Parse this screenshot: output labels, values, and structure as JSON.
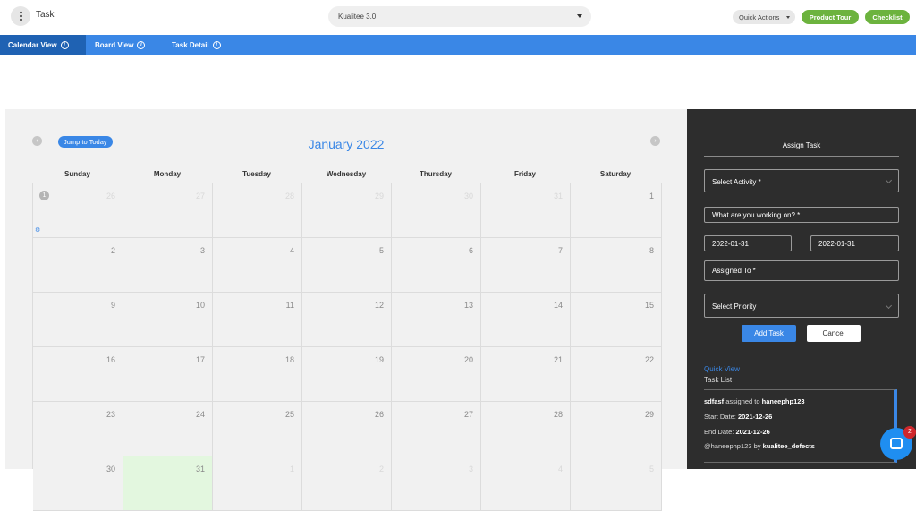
{
  "header": {
    "title": "Task",
    "project": "Kualitee 3.0",
    "quick_actions": "Quick Actions",
    "product_tour": "Product Tour",
    "checklist": "Checklist"
  },
  "tabs": [
    {
      "label": "Calendar View",
      "info": "i"
    },
    {
      "label": "Board View",
      "info": "i"
    },
    {
      "label": "Task Detail",
      "info": "i"
    }
  ],
  "calendar": {
    "jump_today": "Jump to Today",
    "prev_icon": "‹",
    "next_icon": "›",
    "month": "January 2022",
    "weekdays": [
      "Sunday",
      "Monday",
      "Tuesday",
      "Wednesday",
      "Thursday",
      "Friday",
      "Saturday"
    ],
    "weeks": [
      [
        "26",
        "27",
        "28",
        "29",
        "30",
        "31",
        "1"
      ],
      [
        "2",
        "3",
        "4",
        "5",
        "6",
        "7",
        "8"
      ],
      [
        "9",
        "10",
        "11",
        "12",
        "13",
        "14",
        "15"
      ],
      [
        "16",
        "17",
        "18",
        "19",
        "20",
        "21",
        "22"
      ],
      [
        "23",
        "24",
        "25",
        "26",
        "27",
        "28",
        "29"
      ],
      [
        "30",
        "31",
        "1",
        "2",
        "3",
        "4",
        "5"
      ]
    ],
    "event_badge": "1",
    "event_icon": "⚙"
  },
  "assign_task": {
    "title": "Assign Task",
    "activity_placeholder": "Select Activity *",
    "working_on_placeholder": "What are you working on? *",
    "start_date": "2022-01-31",
    "end_date": "2022-01-31",
    "assigned_placeholder": "Assigned To *",
    "priority_placeholder": "Select Priority",
    "add_label": "Add Task",
    "cancel_label": "Cancel"
  },
  "quick_view": {
    "label": "Quick View",
    "task_list_label": "Task List",
    "task": {
      "name": "sdfasf",
      "assigned_text": "assigned to",
      "assignee": "haneephp123",
      "start_label": "Start Date:",
      "start": "2021-12-26",
      "end_label": "End Date:",
      "end": "2021-12-26",
      "mention": "@haneephp123",
      "by_text": "by",
      "project": "kualitee_defects"
    }
  },
  "chat": {
    "badge": "2"
  }
}
